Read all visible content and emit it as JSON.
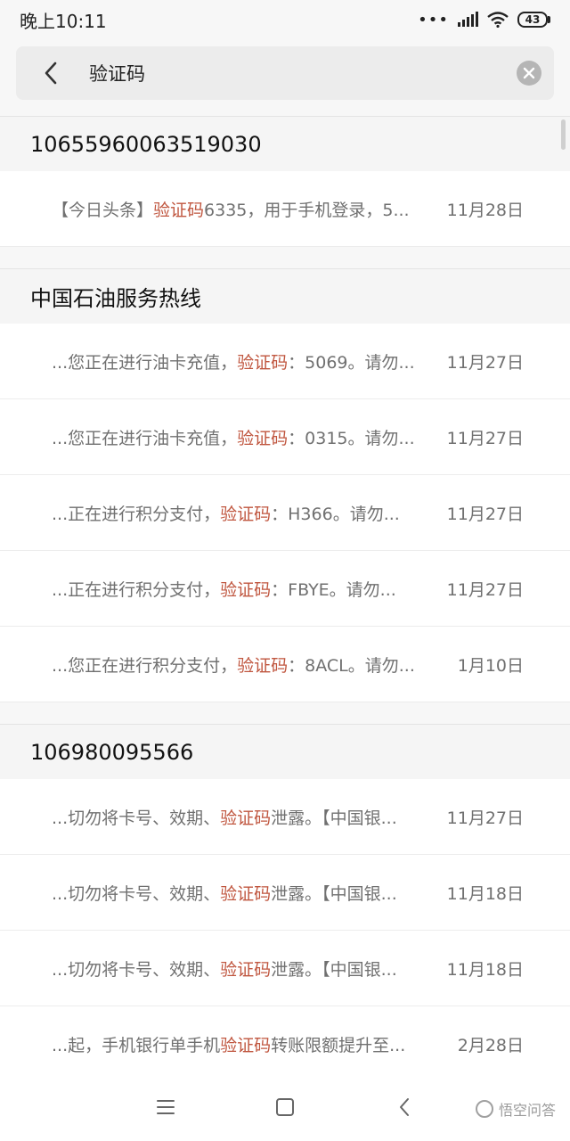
{
  "status_bar": {
    "time": "晚上10:11",
    "battery": "43"
  },
  "search": {
    "query": "验证码"
  },
  "groups": [
    {
      "sender": "10655960063519030",
      "messages": [
        {
          "before": "【今日头条】",
          "keyword": "验证码",
          "after": "6335，用于手机登录，5...",
          "date": "11月28日"
        }
      ]
    },
    {
      "sender": "中国石油服务热线",
      "messages": [
        {
          "before": "...您正在进行油卡充值，",
          "keyword": "验证码",
          "after": "：5069。请勿...",
          "date": "11月27日"
        },
        {
          "before": "...您正在进行油卡充值，",
          "keyword": "验证码",
          "after": "：0315。请勿...",
          "date": "11月27日"
        },
        {
          "before": "...正在进行积分支付，",
          "keyword": "验证码",
          "after": "：H366。请勿...",
          "date": "11月27日"
        },
        {
          "before": "...正在进行积分支付，",
          "keyword": "验证码",
          "after": "：FBYE。请勿...",
          "date": "11月27日"
        },
        {
          "before": "...您正在进行积分支付，",
          "keyword": "验证码",
          "after": "：8ACL。请勿...",
          "date": "1月10日"
        }
      ]
    },
    {
      "sender": "106980095566",
      "messages": [
        {
          "before": "...切勿将卡号、效期、",
          "keyword": "验证码",
          "after": "泄露。【中国银...",
          "date": "11月27日"
        },
        {
          "before": "...切勿将卡号、效期、",
          "keyword": "验证码",
          "after": "泄露。【中国银...",
          "date": "11月18日"
        },
        {
          "before": "...切勿将卡号、效期、",
          "keyword": "验证码",
          "after": "泄露。【中国银...",
          "date": "11月18日"
        },
        {
          "before": "...起，手机银行单手机",
          "keyword": "验证码",
          "after": "转账限额提升至...",
          "date": "2月28日"
        }
      ]
    }
  ],
  "watermark": {
    "text": "悟空问答"
  },
  "colors": {
    "highlight": "#c0563f",
    "background": "#f7f7f7"
  },
  "icons": [
    "back-icon",
    "clear-icon",
    "menu-icon",
    "home-icon",
    "nav-back-icon"
  ]
}
